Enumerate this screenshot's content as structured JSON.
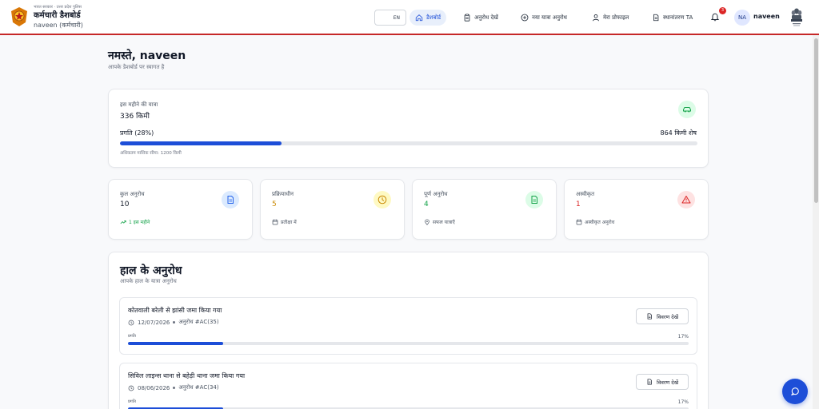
{
  "header": {
    "brand_sup": "भारत सरकार · उत्तर प्रदेश पुलिस",
    "title": "कर्मचारी डैशबोर्ड",
    "subtitle": "naveen (कर्मचारी)",
    "lang_label": "EN",
    "nav": [
      {
        "label": "डैशबोर्ड",
        "icon": "home-icon",
        "active": true
      },
      {
        "label": "अनुरोध देखें",
        "icon": "clipboard-icon"
      },
      {
        "label": "नया यात्रा अनुरोध",
        "icon": "plus-circle-icon"
      },
      {
        "label": "मेरा प्रोफाइल",
        "icon": "user-icon"
      },
      {
        "label": "स्थानांतरण TA",
        "icon": "document-icon"
      }
    ],
    "notification_count": "3",
    "avatar_initials": "NA",
    "user_name": "naveen"
  },
  "greeting": {
    "title": "नमस्ते, naveen",
    "subtitle": "आपके डैशबोर्ड पर स्वागत है"
  },
  "monthly": {
    "label": "इस महीने की यात्रा",
    "value": "336 किमी",
    "progress_label": "प्रगति (28%)",
    "progress_fraction": 0.28,
    "remaining": "864 किमी शेष",
    "limit": "अधिकतम मासिक सीमा: 1200 किमी",
    "icon": "car-icon",
    "accent": "#16a34a"
  },
  "stats": [
    {
      "label": "कुल अनुरोध",
      "value": "10",
      "foot": "1 इस महीने",
      "icon": "document-icon",
      "foot_icon": "trend-up-icon",
      "color": "#111827",
      "foot_color": "#16a34a",
      "icon_bg": "#dbeafe",
      "icon_fg": "#2563eb"
    },
    {
      "label": "प्रक्रियाधीन",
      "value": "5",
      "foot": "प्रतीक्षा में",
      "icon": "clock-icon",
      "foot_icon": "calendar-icon",
      "color": "#ca8a04",
      "foot_color": "#4b5563",
      "icon_bg": "#fef9c3",
      "icon_fg": "#ca8a04"
    },
    {
      "label": "पूर्ण अनुरोध",
      "value": "4",
      "foot": "सफल यात्राएँ",
      "icon": "document-check-icon",
      "foot_icon": "location-pin-icon",
      "color": "#16a34a",
      "foot_color": "#4b5563",
      "icon_bg": "#dcfce7",
      "icon_fg": "#16a34a"
    },
    {
      "label": "अस्वीकृत",
      "value": "1",
      "foot": "अस्वीकृत अनुरोध",
      "icon": "warning-icon",
      "foot_icon": "calendar-icon",
      "color": "#dc2626",
      "foot_color": "#4b5563",
      "icon_bg": "#fee2e2",
      "icon_fg": "#dc2626"
    }
  ],
  "recent": {
    "title": "हाल के अनुरोध",
    "subtitle": "आपके हाल के यात्रा अनुरोध",
    "items": [
      {
        "title": "कोतवाली बरेली से झांसी  जमा किया गया",
        "date": "12/07/2026",
        "ref": "अनुरोध #AC(35)",
        "button": "विवरण देखें",
        "progress_label": "प्रगति",
        "percent": "17%",
        "fraction": 0.17
      },
      {
        "title": "सिविल लाइन्स थाना से बहेड़ी थाना  जमा किया गया",
        "date": "08/06/2026",
        "ref": "अनुरोध #AC(34)",
        "button": "विवरण देखें",
        "progress_label": "प्रगति",
        "percent": "17%",
        "fraction": 0.17
      }
    ]
  },
  "chat_icon": "chat-icon",
  "colors": {
    "primary": "#1d4ed8",
    "header_border": "#c62828"
  }
}
